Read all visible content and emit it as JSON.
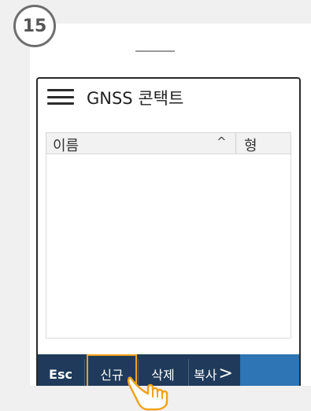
{
  "step": {
    "number": "15"
  },
  "app": {
    "title": "GNSS 콘택트",
    "menu_icon": "hamburger-menu-icon"
  },
  "table": {
    "columns": {
      "name": "이름",
      "type": "형"
    },
    "sort_indicator": "^",
    "rows": []
  },
  "toolbar": {
    "esc_label": "Esc",
    "new_label": "신규",
    "delete_label": "삭제",
    "copy_label": "복사",
    "more_icon": ">"
  },
  "colors": {
    "toolbar_bg": "#1f3a5a",
    "highlight": "#f1a21c",
    "accent_blue": "#2d75b4"
  },
  "annotation": {
    "icon": "pointing-hand-icon"
  }
}
